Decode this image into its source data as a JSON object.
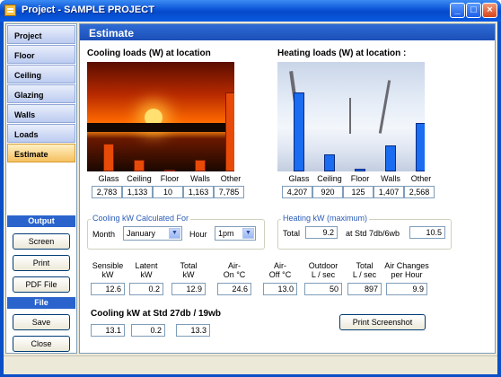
{
  "window": {
    "title": "Project - SAMPLE PROJECT"
  },
  "sidebar": {
    "nav": [
      "Project",
      "Floor",
      "Ceiling",
      "Glazing",
      "Walls",
      "Loads",
      "Estimate"
    ],
    "active": "Estimate",
    "output_header": "Output",
    "output_buttons": [
      "Screen",
      "Print",
      "PDF File"
    ],
    "file_header": "File",
    "file_buttons": [
      "Save",
      "Close"
    ]
  },
  "main": {
    "header": "Estimate",
    "cooling_title": "Cooling loads (W) at location",
    "heating_title": "Heating loads (W) at location :",
    "cooling_kw_group": "Cooling kW Calculated For",
    "month_label": "Month",
    "month_value": "January",
    "hour_label": "Hour",
    "hour_value": "1pm",
    "heating_kw_group": "Heating kW (maximum)",
    "total_label": "Total",
    "total_value": "9.2",
    "std_label": "at Std 7db/6wb",
    "std_value": "10.5",
    "metric_headers": [
      "Sensible\nkW",
      "Latent\nkW",
      "Total\nkW",
      "Air-\nOn °C",
      "Air-\nOff °C",
      "Outdoor\nL / sec",
      "Total\nL / sec",
      "Air Changes\nper Hour"
    ],
    "metric_values": [
      "12.6",
      "0.2",
      "12.9",
      "24.6",
      "13.0",
      "50",
      "897",
      "9.9"
    ],
    "std_cooling_label": "Cooling kW at Std  27db / 19wb",
    "std_cooling_values": [
      "13.1",
      "0.2",
      "13.3"
    ],
    "print_button": "Print Screenshot"
  },
  "chart_data": [
    {
      "type": "bar",
      "title": "Cooling loads (W) at location",
      "categories": [
        "Glass",
        "Ceiling",
        "Floor",
        "Walls",
        "Other"
      ],
      "values": [
        2783,
        1133,
        10,
        1163,
        7785
      ],
      "value_labels": [
        "2,783",
        "1,133",
        "10",
        "1,163",
        "7,785"
      ],
      "color": "#e84a08"
    },
    {
      "type": "bar",
      "title": "Heating loads (W) at location :",
      "categories": [
        "Glass",
        "Ceiling",
        "Floor",
        "Walls",
        "Other"
      ],
      "values": [
        4207,
        920,
        125,
        1407,
        2568
      ],
      "value_labels": [
        "4,207",
        "920",
        "125",
        "1,407",
        "2,568"
      ],
      "color": "#1a6cf0"
    }
  ]
}
